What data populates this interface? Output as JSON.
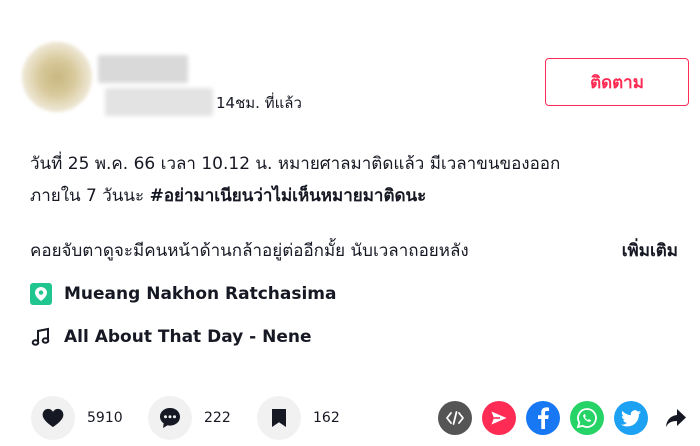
{
  "post": {
    "time_ago": "14ชม. ที่แล้ว",
    "follow_label": "ติดตาม",
    "desc_line1": "วันที่ 25 พ.ค. 66 เวลา 10.12 น. หมายศาลมาติดแล้ว มีเวลาขนของออก",
    "desc_line2_prefix": "ภายใน 7 วันนะ ",
    "desc_hashtag": "#อย่ามาเนียนว่าไม่เห็นหมายมาติดนะ",
    "desc_line3": "คอยจับตาดูจะมีคนหน้าด้านกล้าอยู่ต่ออีกมั้ย นับเวลาถอยหลัง",
    "more_label": "เพิ่มเติม",
    "location": "Mueang Nakhon Ratchasima",
    "music": "All About That Day - Nene"
  },
  "stats": {
    "likes": "5910",
    "comments": "222",
    "saves": "162"
  },
  "colors": {
    "accent": "#fe2c55",
    "location_icon": "#20c58f",
    "embed": "#555555",
    "send": "#fe2c55",
    "facebook": "#1877f2",
    "whatsapp": "#25d366",
    "twitter": "#1da1f2"
  },
  "share_icons": [
    "embed-icon",
    "send-icon",
    "facebook-icon",
    "whatsapp-icon",
    "twitter-icon",
    "share-arrow-icon"
  ]
}
